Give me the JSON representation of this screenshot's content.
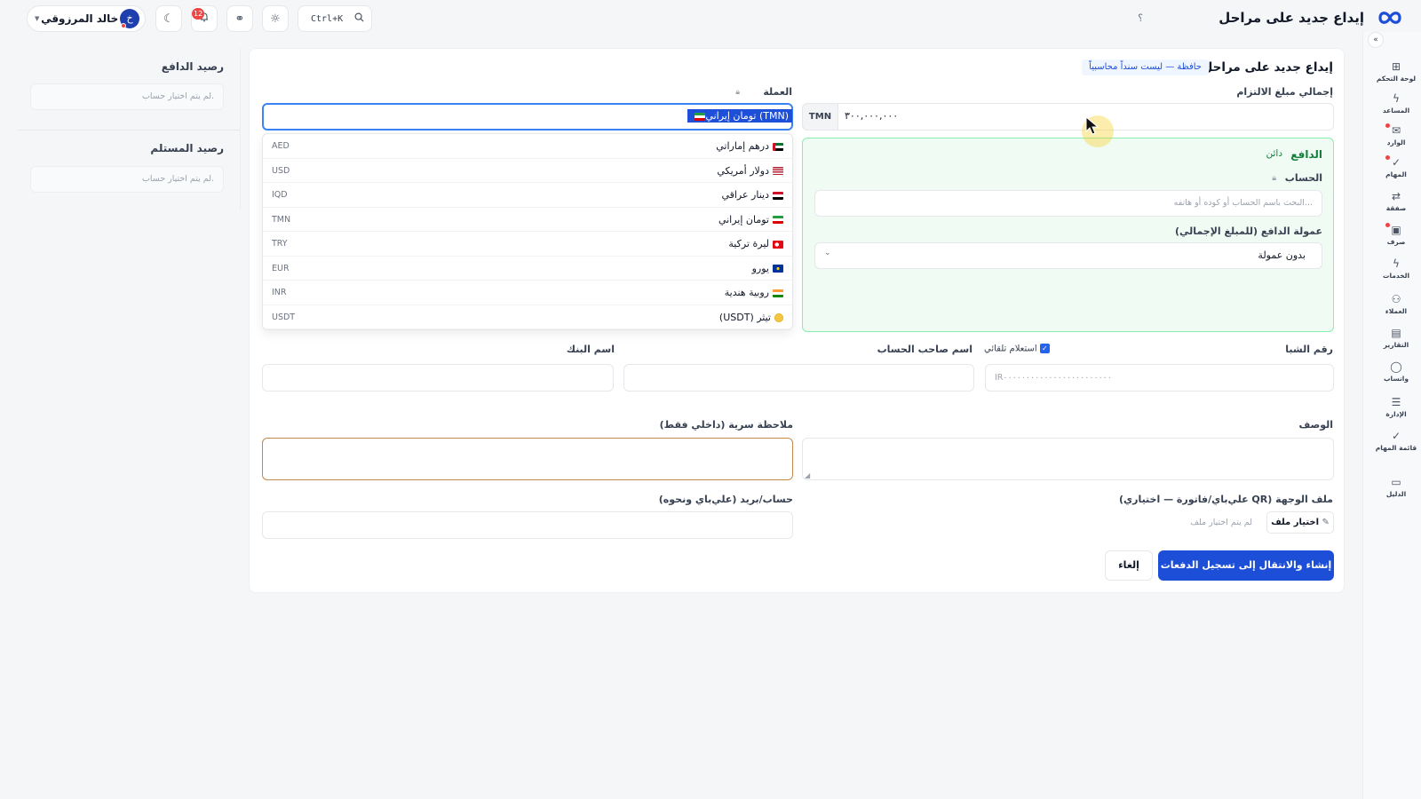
{
  "header": {
    "title": "إيداع جديد على مراحل",
    "help": "؟",
    "search_shortcut": "Ctrl+K",
    "notification_count": "12",
    "user_name": "خالد المرزوقي",
    "user_initial": "خ"
  },
  "sidebar": {
    "collapse": "«",
    "items": [
      {
        "label": "لوحة التحكم",
        "icon": "dashboard-icon",
        "glyph": "⊞"
      },
      {
        "label": "المساعد",
        "icon": "bolt-icon",
        "glyph": "ϟ"
      },
      {
        "label": "الوارد",
        "icon": "inbox-icon",
        "glyph": "✉"
      },
      {
        "label": "المهام",
        "icon": "check-icon",
        "glyph": "✓"
      },
      {
        "label": "صفقة",
        "icon": "exchange-icon",
        "glyph": "⇄"
      },
      {
        "label": "صرف",
        "icon": "cash-icon",
        "glyph": "▣"
      },
      {
        "label": "الخدمات",
        "icon": "bolt-icon",
        "glyph": "ϟ"
      },
      {
        "label": "العملاء",
        "icon": "users-icon",
        "glyph": "⚇"
      },
      {
        "label": "التقارير",
        "icon": "report-icon",
        "glyph": "▤"
      },
      {
        "label": "واتساب",
        "icon": "chat-icon",
        "glyph": "◯"
      },
      {
        "label": "الإدارة",
        "icon": "sliders-icon",
        "glyph": "☰"
      },
      {
        "label": "قائمة المهام",
        "icon": "checklist-icon",
        "glyph": "✓"
      },
      {
        "label": "الدليل",
        "icon": "book-icon",
        "glyph": "▭"
      }
    ]
  },
  "form": {
    "title": "إيداع جديد على مراحل",
    "tag": "حافظة — ليست سنداً محاسبياً",
    "amount_label": "إجمالي مبلغ الالتزام",
    "amount_value": "۳۰۰,۰۰۰,۰۰۰",
    "amount_currency": "TMN",
    "currency_label": "العملة",
    "currency_selected": "تومان إيراني (TMN)",
    "payer": {
      "title": "الدافع",
      "status": "دائن",
      "account_label": "الحساب",
      "account_placeholder": "البحث باسم الحساب أو كوده أو هاتفه...",
      "commission_label": "عمولة الدافع (للمبلغ الإجمالي)",
      "commission_value": "بدون عمولة"
    },
    "currencies": [
      {
        "name": "درهم إماراتي",
        "code": "AED",
        "flag": "ae"
      },
      {
        "name": "دولار أمريكي",
        "code": "USD",
        "flag": "us"
      },
      {
        "name": "دينار عراقي",
        "code": "IQD",
        "flag": "iq"
      },
      {
        "name": "تومان إيراني",
        "code": "TMN",
        "flag": "ir"
      },
      {
        "name": "ليرة تركية",
        "code": "TRY",
        "flag": "tr"
      },
      {
        "name": "يورو",
        "code": "EUR",
        "flag": "eu"
      },
      {
        "name": "روبية هندية",
        "code": "INR",
        "flag": "in"
      },
      {
        "name": "تيثر (USDT)",
        "code": "USDT",
        "flag": "usdt"
      }
    ],
    "sheba_label": "رقم الشبا",
    "sheba_placeholder": "IR۰۰۰۰۰۰۰۰۰۰۰۰۰۰۰۰۰۰۰۰۰۰۰۰",
    "auto_inquiry": "استعلام تلقائي",
    "holder_label": "اسم صاحب الحساب",
    "bank_label": "اسم البنك",
    "desc_label": "الوصف",
    "secret_label": "ملاحظة سرية (داخلي فقط)",
    "file_label": "ملف الوجهة (QR علي‌باي/فاتورة — اختياري)",
    "file_button": "اختيار ملف",
    "file_status": "لم يتم اختيار ملف",
    "account_email_label": "حساب/بريد (علي‌باي ونحوه)",
    "submit": "إنشاء والانتقال إلى تسجيل الدفعات",
    "cancel": "إلغاء"
  },
  "left_panel": {
    "payer_balance": "رصيد الدافع",
    "receiver_balance": "رصيد المستلم",
    "no_account": "لم يتم اختيار حساب."
  }
}
